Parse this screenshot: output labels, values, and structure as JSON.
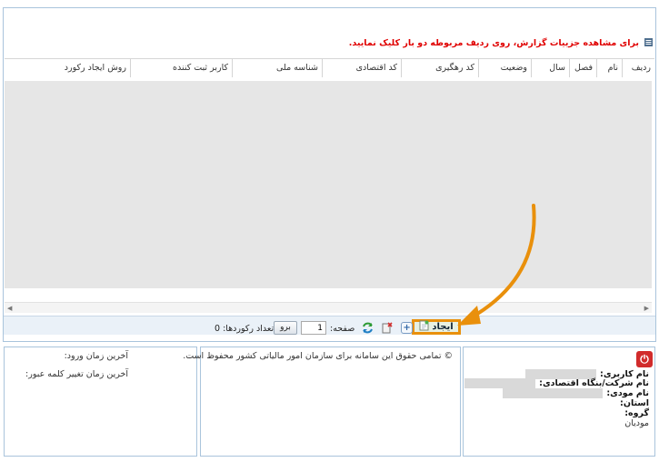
{
  "hint": {
    "text": "برای مشاهده جزییات گزارش، روی ردیف مربوطه دو بار کلیک نمایید."
  },
  "grid": {
    "columns": [
      "ردیف",
      "نام",
      "فصل",
      "سال",
      "وضعیت",
      "کد رهگیری",
      "کد اقتصادی",
      "شناسه ملی",
      "کاربر ثبت کننده",
      "روش ایجاد رکورد"
    ]
  },
  "toolbar": {
    "create_label": "ایجاد",
    "page_label": "صفحه:",
    "page_value": "1",
    "go_label": "برو",
    "records_label": "تعداد رکوردها: 0"
  },
  "footer": {
    "copyright": "© تمامی حقوق این سامانه برای سازمان امور مالیاتی کشور محفوظ است.",
    "last_login_label": "آخرین زمان ورود:",
    "last_password_change_label": "آخرین زمان تغییر کلمه عبور:",
    "user_info": {
      "username_label": "نام کاربری:",
      "company_label": "نام شرکت/بنگاه اقتصادی:",
      "taxpayer_label": "نام مودی:",
      "province_label": "استان:",
      "group_label": "گروه:",
      "group_value": "مودیان"
    }
  },
  "colors": {
    "highlight_border": "#e9900c",
    "arrow": "#e9900c",
    "hint_text": "#e00000",
    "grid_body": "#e6e6e6"
  }
}
